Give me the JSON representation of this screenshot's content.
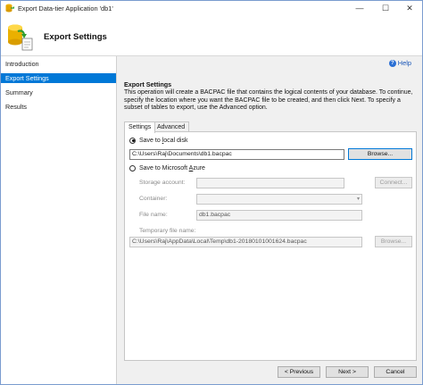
{
  "window": {
    "title": "Export Data-tier Application 'db1'",
    "controls": {
      "minimize": "—",
      "maximize": "☐",
      "close": "✕"
    }
  },
  "header": {
    "title": "Export Settings"
  },
  "sidebar": {
    "items": [
      {
        "label": "Introduction",
        "active": false
      },
      {
        "label": "Export Settings",
        "active": true
      },
      {
        "label": "Summary",
        "active": false
      },
      {
        "label": "Results",
        "active": false
      }
    ]
  },
  "help": {
    "label": "Help"
  },
  "section": {
    "title": "Export Settings",
    "description": "This operation will create a BACPAC file that contains the logical contents of your database. To continue, specify the location where you want the BACPAC file to be created, and then click Next. To specify a subset of tables to export, use the Advanced option."
  },
  "tabs": [
    {
      "label": "Settings",
      "active": true
    },
    {
      "label": "Advanced",
      "active": false
    }
  ],
  "local_disk": {
    "label_pre": "Save to ",
    "label_key": "l",
    "label_post": "ocal disk",
    "checked": true,
    "path_value": "C:\\Users\\Raj\\Documents\\db1.bacpac",
    "browse_label": "Browse..."
  },
  "azure": {
    "label_pre": "Save to Microsoft ",
    "label_key": "A",
    "label_post": "zure",
    "checked": false,
    "storage_account_label": "Storage account:",
    "connect_label": "Connect...",
    "container_label": "Container:",
    "file_name_label": "File name:",
    "file_name_value": "db1.bacpac",
    "temp_file_label": "Temporary file name:",
    "temp_file_value": "C:\\Users\\Raj\\AppData\\Local\\Temp\\db1-20180101001624.bacpac",
    "browse_label": "Browse..."
  },
  "footer": {
    "previous_label": "< Previous",
    "next_label": "Next >",
    "cancel_label": "Cancel"
  },
  "colors": {
    "accent": "#0078d7",
    "link": "#1a56b8"
  }
}
